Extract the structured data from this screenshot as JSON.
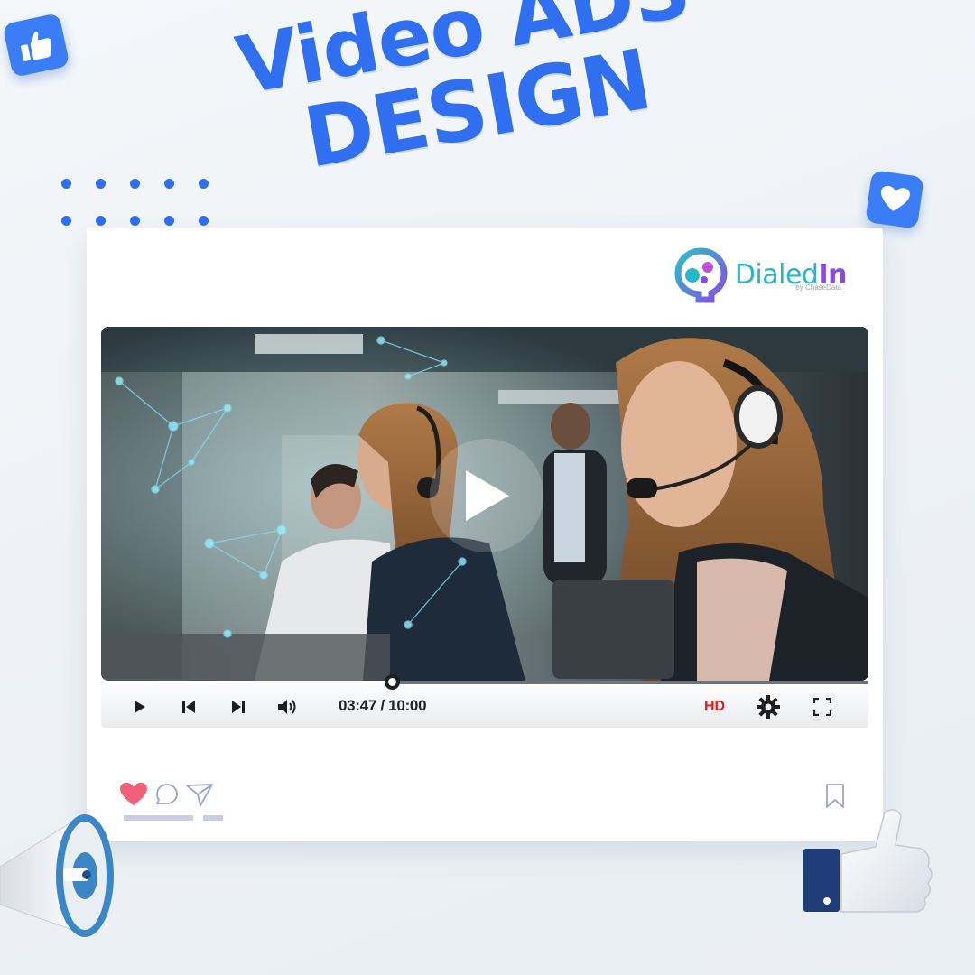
{
  "headline": {
    "line1": "Video ADS",
    "line2": "DESIGN"
  },
  "brand": {
    "name_part1": "Dialed",
    "name_part2": "In",
    "sub": "by ChaseData"
  },
  "player": {
    "progress": 0.3783,
    "time_current": "03:47",
    "time_separator": " / ",
    "time_total": "10:00",
    "quality_label": "HD"
  },
  "colors": {
    "accent": "#2f6ff0",
    "brand_teal": "#25b8c9",
    "brand_purple": "#8a4be0",
    "hd_red": "#e01e1e",
    "heart": "#f0607a"
  },
  "icons": {
    "badge_top_left": "thumbs-up-icon",
    "badge_right": "heart-icon",
    "controls": [
      "play-icon",
      "skip-back-icon",
      "skip-forward-icon",
      "volume-icon",
      "settings-gear-icon",
      "fullscreen-icon"
    ],
    "social": [
      "heart-icon",
      "comment-icon",
      "share-icon",
      "bookmark-icon"
    ]
  }
}
